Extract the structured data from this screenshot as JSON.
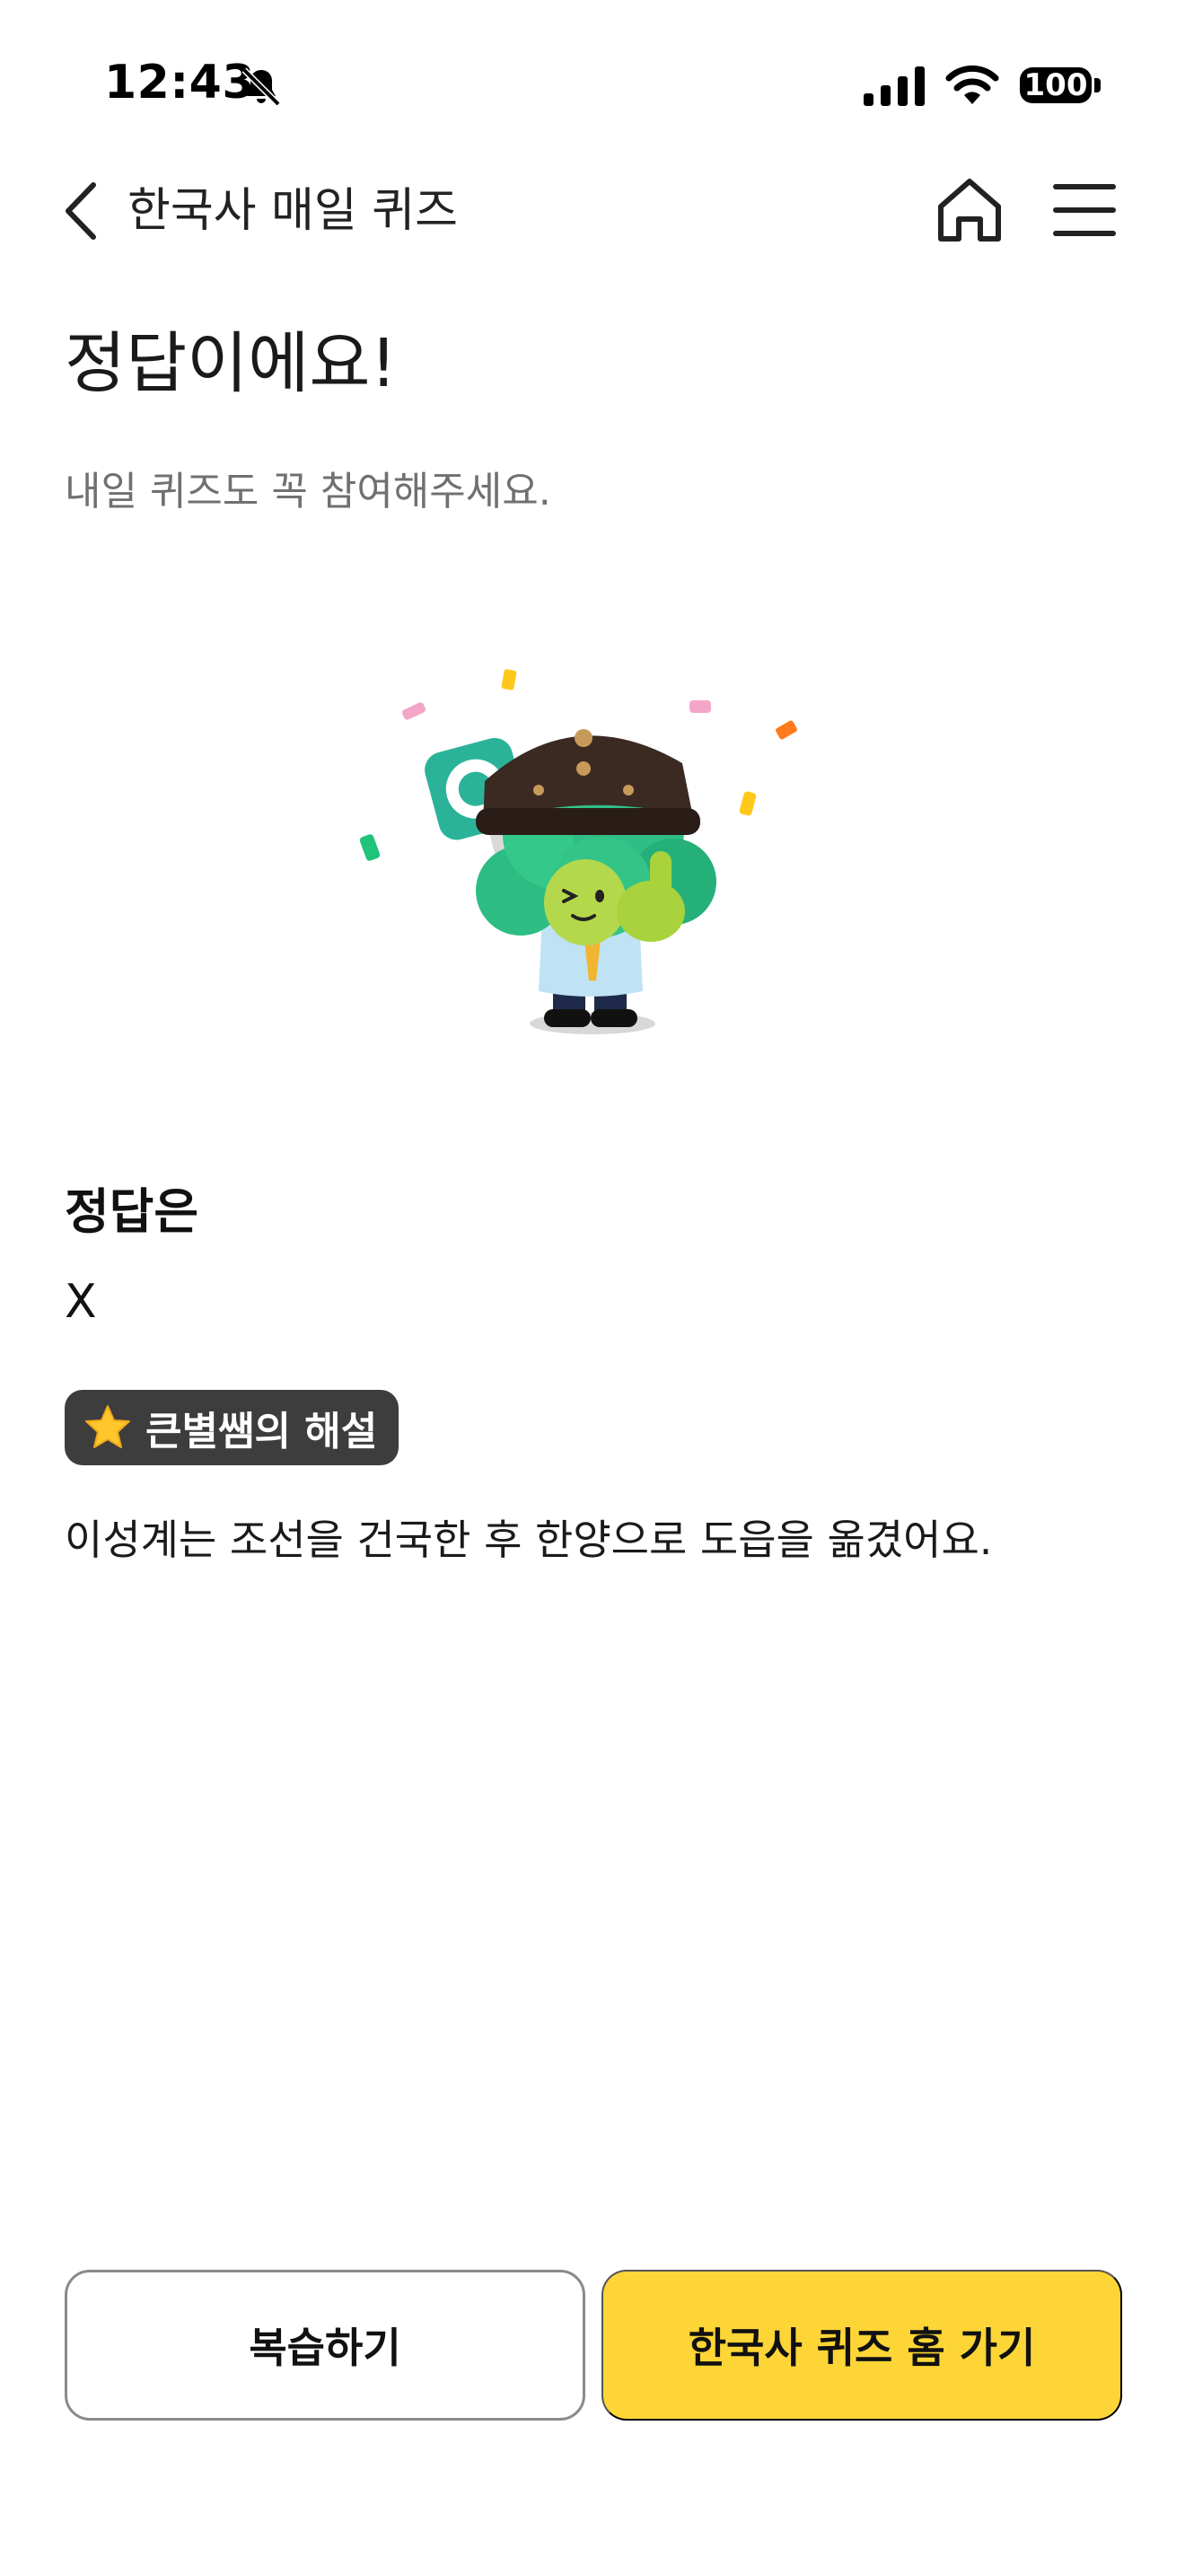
{
  "status_bar": {
    "time": "12:43",
    "battery": "100"
  },
  "nav": {
    "title": "한국사 매일 퀴즈",
    "icons": [
      "back-icon",
      "home-icon",
      "menu-icon"
    ]
  },
  "result": {
    "headline": "정답이에요!",
    "subline": "내일 퀴즈도 꼭 참여해주세요."
  },
  "answer": {
    "heading": "정답은",
    "value": "X"
  },
  "explanation": {
    "badge_label": "큰별쌤의 해설",
    "text": "이성계는 조선을 건국한 후 한양으로 도읍을 옮겼어요."
  },
  "buttons": {
    "review": "복습하기",
    "quiz_home": "한국사 퀴즈 홈 가기"
  },
  "colors": {
    "primary_button": "#fed537",
    "badge_background": "#3d3d3d",
    "subtext": "#707070"
  }
}
